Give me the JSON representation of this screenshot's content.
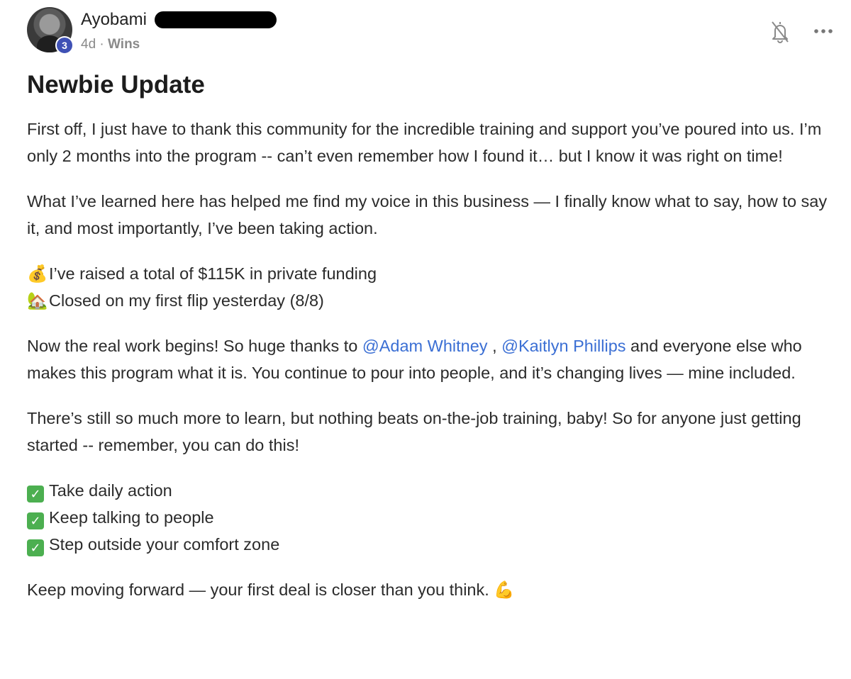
{
  "author": {
    "name": "Ayobami",
    "level": "3",
    "time": "4d",
    "separator": "·",
    "category": "Wins"
  },
  "icons": {
    "bell": "bell-off-icon",
    "more": "more-options-icon"
  },
  "post": {
    "title": "Newbie Update",
    "p1": "First off, I just have to thank this community for the incredible training and support you’ve poured into us. I’m only 2 months into the program -- can’t even remember how I found it… but I know it was right on time!",
    "p2": "What I’ve learned here has helped me find my voice in this business — I finally know what to say, how to say it, and most importantly, I’ve been taking action.",
    "bullet1": {
      "emoji": "💰",
      "text": "I’ve raised a total of $115K in private funding"
    },
    "bullet2": {
      "emoji": "🏡",
      "text": "Closed on my first flip yesterday (8/8)"
    },
    "p3_before": "Now the real work begins! So huge thanks to ",
    "mention1": "@Adam Whitney",
    "p3_between": " , ",
    "mention2": "@Kaitlyn Phillips",
    "p3_after": " and everyone else who makes this program what it is. You continue to pour into people, and it’s changing lives — mine included.",
    "p4": "There’s still so much more to learn, but nothing beats on-the-job training, baby! So for anyone just getting started -- remember, you can do this!",
    "checks": [
      {
        "mark": "✓",
        "text": "Take daily action"
      },
      {
        "mark": "✓",
        "text": "Keep talking to people"
      },
      {
        "mark": "✓",
        "text": "Step outside your comfort zone"
      }
    ],
    "closing": "Keep moving forward — your first deal is closer than you think.",
    "closing_emoji": "💪"
  },
  "colors": {
    "mention": "#3b6fd4",
    "level_badge": "#3f51b5",
    "check": "#4caf50"
  }
}
